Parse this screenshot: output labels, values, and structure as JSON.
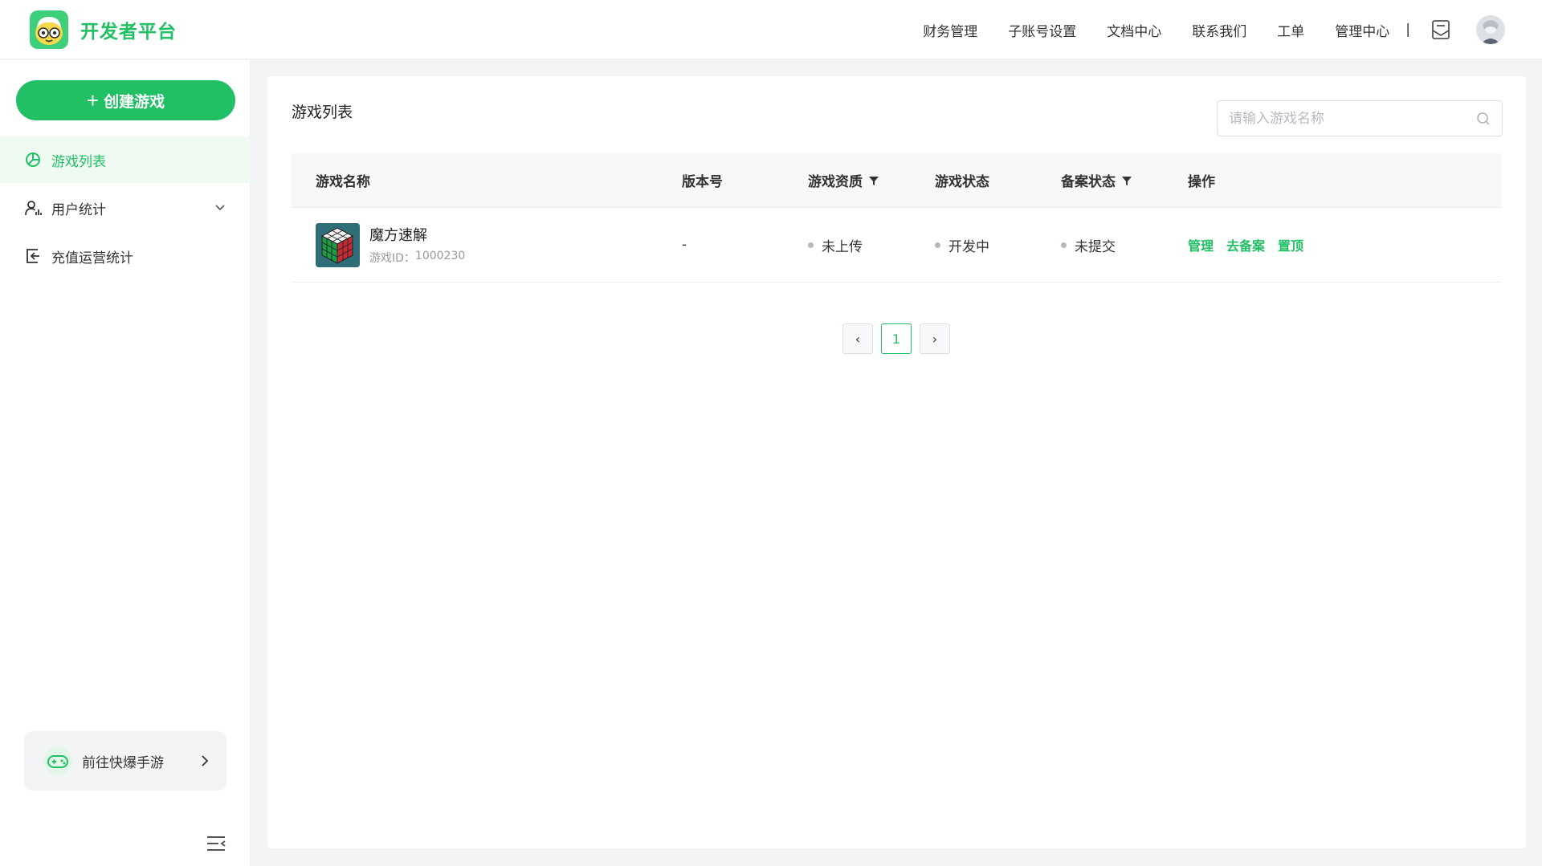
{
  "header": {
    "brand": "开发者平台",
    "nav": [
      "财务管理",
      "子账号设置",
      "文档中心",
      "联系我们",
      "工单",
      "管理中心"
    ],
    "separator": "|"
  },
  "sidebar": {
    "create_label": "创建游戏",
    "items": [
      {
        "label": "游戏列表",
        "active": true
      },
      {
        "label": "用户统计",
        "active": false
      },
      {
        "label": "充值运营统计",
        "active": false
      }
    ],
    "promo_label": "前往快爆手游"
  },
  "main": {
    "title": "游戏列表",
    "search_placeholder": "请输入游戏名称",
    "columns": [
      "游戏名称",
      "版本号",
      "游戏资质",
      "游戏状态",
      "备案状态",
      "操作"
    ],
    "rows": [
      {
        "name": "魔方速解",
        "id_label": "游戏ID：",
        "id": "1000230",
        "version": "-",
        "qualification": "未上传",
        "status": "开发中",
        "record_status": "未提交",
        "actions": [
          "管理",
          "去备案",
          "置顶"
        ]
      }
    ],
    "pagination": {
      "current": "1",
      "prev": "‹",
      "next": "›"
    }
  },
  "colors": {
    "accent": "#22c064",
    "accent_light": "#effaf3"
  }
}
